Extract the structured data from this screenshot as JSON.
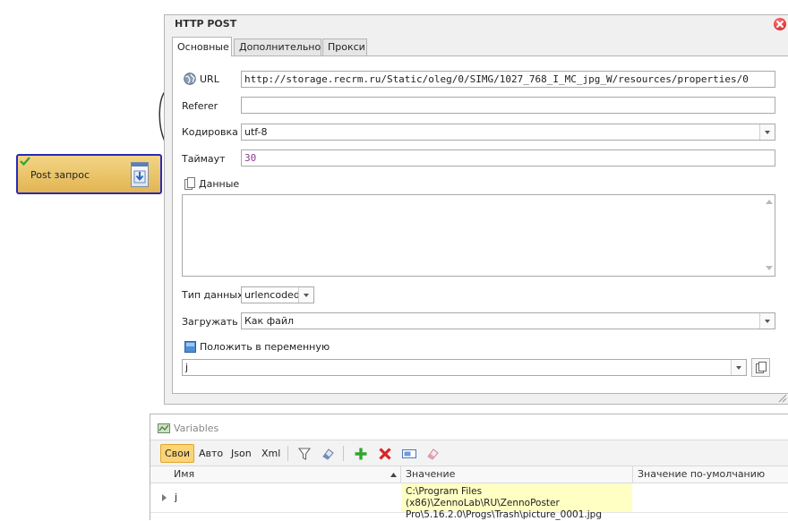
{
  "canvas": {
    "action_block": {
      "title": "Post запрос",
      "icon": "download-arrow-icon",
      "status_icon": "green-check-icon"
    }
  },
  "dialog": {
    "title": "HTTP POST",
    "tabs": [
      {
        "label": "Основные",
        "active": true
      },
      {
        "label": "Дополнительно",
        "active": false
      },
      {
        "label": "Прокси",
        "active": false
      }
    ],
    "fields": {
      "url_label": "URL",
      "url_value": "http://storage.recrm.ru/Static/oleg/0/SIMG/1027_768_I_MC_jpg_W/resources/properties/0",
      "referer_label": "Referer",
      "referer_value": "",
      "encoding_label": "Кодировка",
      "encoding_value": "utf-8",
      "timeout_label": "Таймаут",
      "timeout_value": "30",
      "data_label": "Данные",
      "data_value": "",
      "data_type_label": "Тип данных",
      "data_type_value": "urlencoded",
      "load_label": "Загружать",
      "load_value": "Как файл",
      "save_var_label": "Положить в переменную",
      "save_var_value": "j"
    }
  },
  "variables": {
    "title": "Variables",
    "tabs": [
      "Свои",
      "Авто",
      "Json",
      "Xml"
    ],
    "active_tab": "Свои",
    "columns": [
      "Имя",
      "Значение",
      "Значение по-умолчанию"
    ],
    "rows": [
      {
        "name": "j",
        "value_line1": "C:\\Program Files (x86)\\ZennoLab\\RU\\ZennoPoster",
        "value_line2": "Pro\\5.16.2.0\\Progs\\Trash\\picture_0001.jpg",
        "default": ""
      }
    ]
  },
  "colors": {
    "block_fill": "#e9c467",
    "block_border": "#2a2ab8",
    "active_tab": "#fbd477",
    "value_highlight": "#ffffc4",
    "timeout_text": "#8b3a8b"
  }
}
